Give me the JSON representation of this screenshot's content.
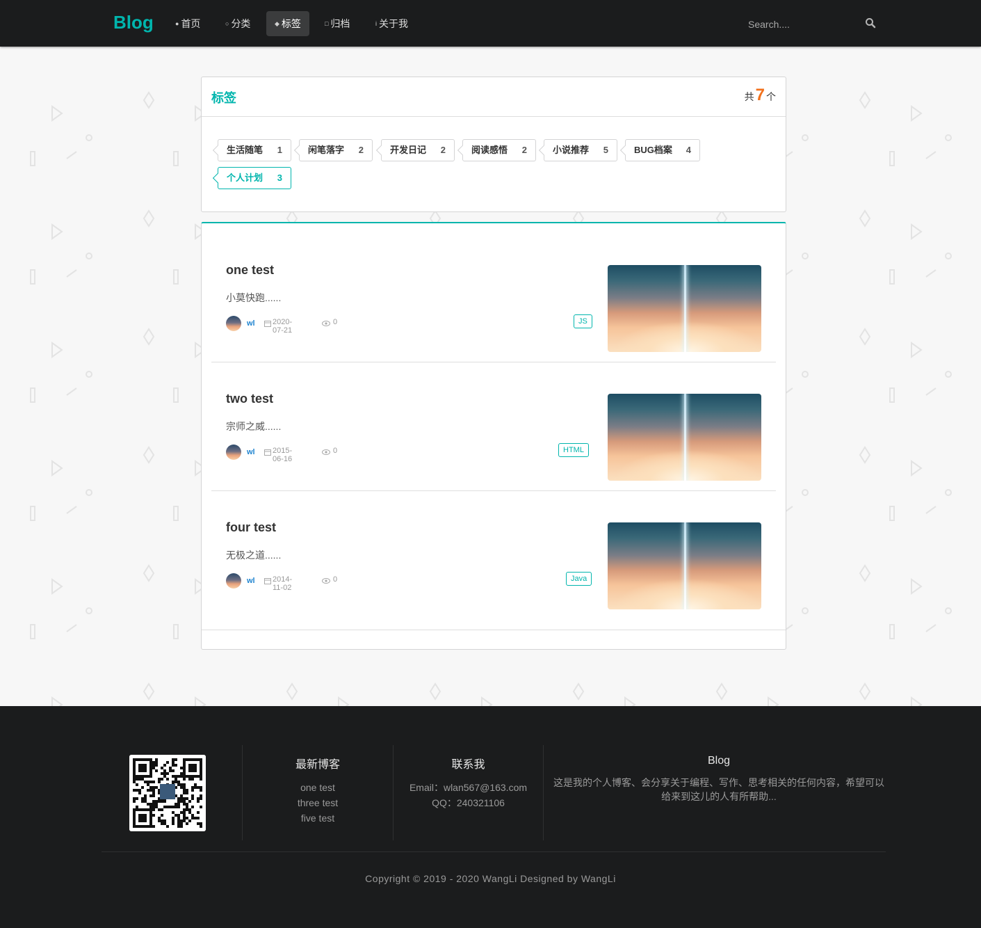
{
  "brand": "Blog",
  "nav": {
    "items": [
      {
        "icon": "home-icon",
        "label": "首页"
      },
      {
        "icon": "idea-icon",
        "label": "分类"
      },
      {
        "icon": "tags-icon",
        "label": "标签"
      },
      {
        "icon": "clone-icon",
        "label": "归档"
      },
      {
        "icon": "info-icon",
        "label": "关于我"
      }
    ],
    "active": "标签",
    "search_placeholder": "Search...."
  },
  "tags_card": {
    "title": "标签",
    "count_prefix": "共",
    "count": "7",
    "count_suffix": "个",
    "tags": [
      {
        "name": "生活随笔",
        "count": "1"
      },
      {
        "name": "闲笔落字",
        "count": "2"
      },
      {
        "name": "开发日记",
        "count": "2"
      },
      {
        "name": "阅读感悟",
        "count": "2"
      },
      {
        "name": "小说推荐",
        "count": "5"
      },
      {
        "name": "BUG档案",
        "count": "4"
      },
      {
        "name": "个人计划",
        "count": "3"
      }
    ],
    "active_tag": "个人计划"
  },
  "posts": [
    {
      "title": "one test",
      "excerpt": "小莫快跑......",
      "author": "wl",
      "date": "2020-07-21",
      "views": "0",
      "label": "JS"
    },
    {
      "title": "two test",
      "excerpt": "宗师之威......",
      "author": "wl",
      "date": "2015-06-16",
      "views": "0",
      "label": "HTML"
    },
    {
      "title": "four test",
      "excerpt": "无极之道......",
      "author": "wl",
      "date": "2014-11-02",
      "views": "0",
      "label": "Java"
    }
  ],
  "footer": {
    "latest": {
      "heading": "最新博客",
      "items": [
        "one test",
        "three test",
        "five test"
      ]
    },
    "contact": {
      "heading": "联系我",
      "email": "Email：wlan567@163.com",
      "qq": "QQ：240321106"
    },
    "about": {
      "heading": "Blog",
      "text": "这是我的个人博客、会分享关于编程、写作、思考相关的任何内容，希望可以给来到这儿的人有所帮助..."
    },
    "copyright": "Copyright © 2019 - 2020 WangLi Designed by WangLi"
  },
  "colors": {
    "accent": "#00b5ad",
    "count": "#f2711c",
    "nav_bg": "#1b1c1d",
    "author": "#2185d0"
  }
}
